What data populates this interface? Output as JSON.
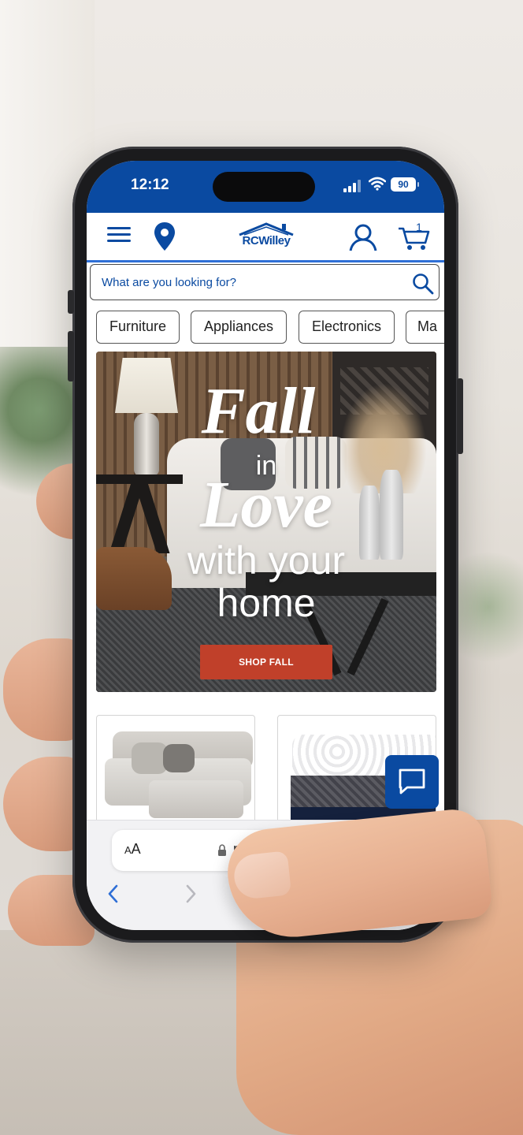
{
  "status_bar": {
    "time": "12:12",
    "battery": "90"
  },
  "header": {
    "logo_text": "RCWilley",
    "cart_count": "1"
  },
  "search": {
    "placeholder": "What are you looking for?"
  },
  "categories": [
    {
      "label": "Furniture"
    },
    {
      "label": "Appliances"
    },
    {
      "label": "Electronics"
    },
    {
      "label": "Ma"
    }
  ],
  "hero": {
    "line1": "Fall",
    "line2": "in",
    "line3": "Love",
    "line4": "with your",
    "line5": "home",
    "button_label": "SHOP FALL"
  },
  "products": [
    {
      "name": "sectional-sofa"
    },
    {
      "name": "mattress"
    }
  ],
  "browser": {
    "text_size_label_small": "A",
    "text_size_label_large": "A",
    "url": "rcw"
  },
  "colors": {
    "brand_blue": "#0a4aa1",
    "accent_link": "#2f6fd6",
    "cta_red": "#c0402a"
  },
  "icons": [
    "menu-icon",
    "location-icon",
    "account-icon",
    "cart-icon",
    "search-icon",
    "chat-icon",
    "lock-icon",
    "chevron-left-icon",
    "chevron-right-icon",
    "signal-icon",
    "wifi-icon",
    "battery-icon"
  ]
}
